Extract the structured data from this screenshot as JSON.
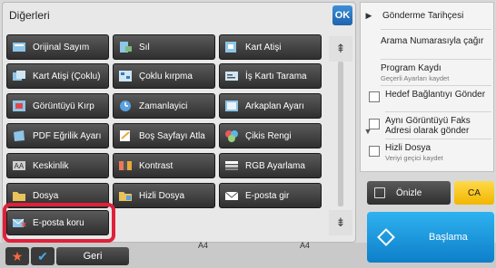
{
  "panel_title": "Diğerleri",
  "ok_label": "OK",
  "buttons": [
    {
      "label": "Orijinal Sayım",
      "icon": "original-count-icon",
      "color": "#8ec5e8"
    },
    {
      "label": "Sıl",
      "icon": "erase-icon",
      "color": "#7fb87a"
    },
    {
      "label": "Kart Atişi",
      "icon": "card-shot-icon",
      "color": "#8ec5e8"
    },
    {
      "label": "Kart Atişi (Çoklu)",
      "icon": "card-shot-multi-icon",
      "color": "#8ec5e8"
    },
    {
      "label": "Çoklu kırpma",
      "icon": "multi-crop-icon",
      "color": "#8ec5e8"
    },
    {
      "label": "İş Kartı Tarama",
      "icon": "business-card-scan-icon",
      "color": "#8ec5e8"
    },
    {
      "label": "Görüntüyü Kırp",
      "icon": "crop-image-icon",
      "color": "#8ec5e8"
    },
    {
      "label": "Zamanlayici",
      "icon": "timer-icon",
      "color": "#5aa0e0"
    },
    {
      "label": "Arkaplan Ayarı",
      "icon": "background-icon",
      "color": "#8ec5e8"
    },
    {
      "label": "PDF Eğrilik Ayarı",
      "icon": "pdf-skew-icon",
      "color": "#8ec5e8"
    },
    {
      "label": "Boş Sayfayı Atla",
      "icon": "skip-blank-icon",
      "color": "#e8d78e"
    },
    {
      "label": "Çikis Rengi",
      "icon": "output-color-icon",
      "color": "#9ad07a"
    },
    {
      "label": "Keskinlik",
      "icon": "sharpness-icon",
      "color": "#cfcfcf"
    },
    {
      "label": "Kontrast",
      "icon": "contrast-icon",
      "color": "#e87a5a"
    },
    {
      "label": "RGB Ayarlama",
      "icon": "rgb-icon",
      "color": "#cfcfcf"
    },
    {
      "label": "Dosya",
      "icon": "file-icon",
      "color": "#e8c25a"
    },
    {
      "label": "Hizli Dosya",
      "icon": "quick-file-icon",
      "color": "#e8c25a"
    },
    {
      "label": "E-posta gir",
      "icon": "email-enter-icon",
      "color": "#8ec5e8"
    },
    {
      "label": "E-posta koru",
      "icon": "email-protect-icon",
      "color": "#8ec5e8"
    }
  ],
  "bottom": {
    "back_label": "Geri",
    "paper_1": "A4",
    "paper_2": "A4"
  },
  "history": {
    "title": "Gönderme Tarihçesi",
    "items": [
      {
        "label": "Arama Numarasıyla çağır",
        "sub": ""
      },
      {
        "label": "Program Kaydı",
        "sub": "Geçerli Ayarları kaydet"
      },
      {
        "label": "Hedef Bağlantıyı Gönder",
        "sub": ""
      },
      {
        "label": "Aynı Görüntüyü Faks Adresi olarak gönder",
        "sub": ""
      },
      {
        "label": "Hizli Dosya",
        "sub": "Veriyi geçici kaydet"
      }
    ]
  },
  "preview_label": "Önizle",
  "ca_label": "CA",
  "start_label": "Başlama"
}
